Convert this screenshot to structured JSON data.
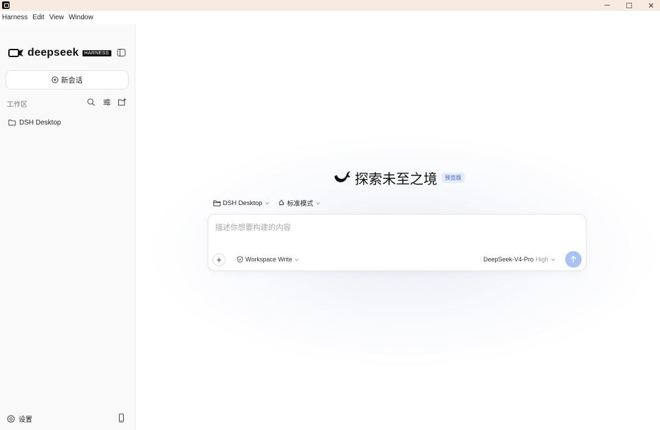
{
  "titlebar": {
    "minimize_glyph": "─",
    "maximize_glyph": "☐",
    "close_glyph": "✕"
  },
  "menu": {
    "items": [
      "Harness",
      "Edit",
      "View",
      "Window"
    ]
  },
  "sidebar": {
    "brand_name": "deepseek",
    "brand_badge": "HARNESS",
    "new_chat_label": "新会话",
    "workspace_label": "工作区",
    "workspaces": [
      {
        "label": "DSH Desktop",
        "icon": "folder-icon"
      }
    ],
    "settings_label": "设置"
  },
  "main": {
    "hero_title": "探索未至之境",
    "hero_badge": "预览版",
    "context": {
      "folder_label": "DSH Desktop",
      "mode_label": "标准模式"
    },
    "composer": {
      "placeholder": "描述你想要构建的内容",
      "value": "",
      "attach_glyph": "+",
      "permission_label": "Workspace Write",
      "model_name": "DeepSeek-V4-Pro",
      "model_level": "High"
    }
  },
  "colors": {
    "titlebar_bg": "#f7ebe0",
    "sidebar_bg": "#f9f9fa",
    "send_button": "#a9c2f6",
    "badge_text": "#3c5cc8",
    "badge_bg": "#e5ecfb"
  }
}
